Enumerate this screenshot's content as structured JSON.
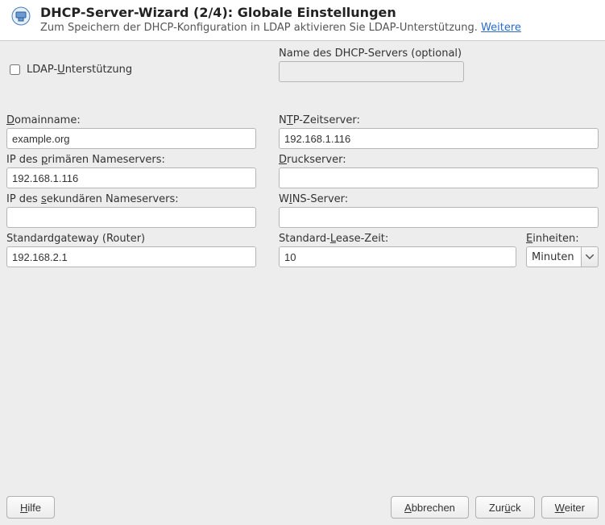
{
  "header": {
    "title": "DHCP-Server-Wizard (2/4): Globale Einstellungen",
    "subtitle_prefix": "Zum Speichern der DHCP-Konfiguration in LDAP aktivieren Sie LDAP-Unterstützung. ",
    "subtitle_link": "Weitere"
  },
  "ldap": {
    "checkbox_label_pre": "LDAP-",
    "checkbox_label_u": "U",
    "checkbox_label_post": "nterstützung",
    "checked": false
  },
  "dhcp_name": {
    "label": "Name des DHCP-Servers (optional)",
    "value": ""
  },
  "left": {
    "domain": {
      "label_u": "D",
      "label_rest": "omainname:",
      "value": "example.org"
    },
    "primary_ns": {
      "label_pre": "IP des ",
      "label_u": "p",
      "label_post": "rimären Nameservers:",
      "value": "192.168.1.116"
    },
    "secondary_ns": {
      "label_pre": "IP des ",
      "label_u": "s",
      "label_post": "ekundären Nameservers:",
      "value": ""
    },
    "gateway": {
      "label": "Standardgateway (Router)",
      "value": "192.168.2.1"
    }
  },
  "right": {
    "ntp": {
      "label_pre": "N",
      "label_u": "T",
      "label_post": "P-Zeitserver:",
      "value": "192.168.1.116"
    },
    "print": {
      "label_u": "D",
      "label_rest": "ruckserver:",
      "value": ""
    },
    "wins": {
      "label_pre": "W",
      "label_u": "I",
      "label_post": "NS-Server:",
      "value": ""
    },
    "lease": {
      "label_pre": "Standard-",
      "label_u": "L",
      "label_post": "ease-Zeit:",
      "value": "10"
    },
    "units": {
      "label_u": "E",
      "label_rest": "inheiten:",
      "value": "Minuten"
    }
  },
  "footer": {
    "help_u": "H",
    "help_rest": "ilfe",
    "cancel_u": "A",
    "cancel_rest": "bbrechen",
    "back_pre": "Zur",
    "back_u": "ü",
    "back_post": "ck",
    "next_u": "W",
    "next_rest": "eiter"
  }
}
